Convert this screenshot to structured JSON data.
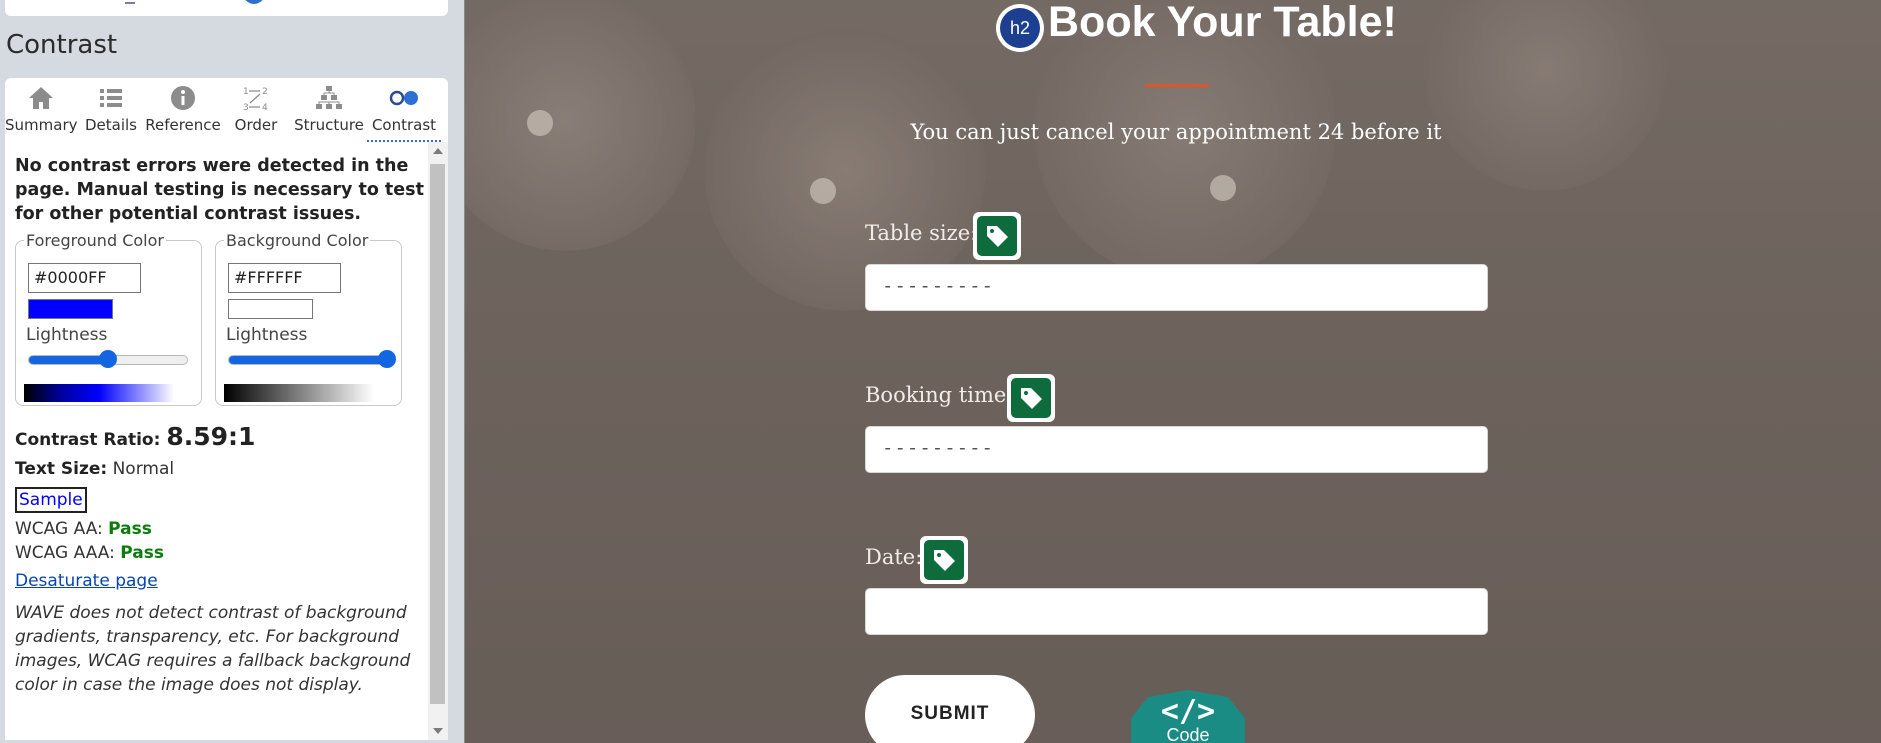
{
  "sidebar": {
    "section_title": "Contrast",
    "tabs": [
      {
        "label": "Summary",
        "icon": "home-icon"
      },
      {
        "label": "Details",
        "icon": "list-icon"
      },
      {
        "label": "Reference",
        "icon": "info-icon"
      },
      {
        "label": "Order",
        "icon": "order-icon"
      },
      {
        "label": "Structure",
        "icon": "structure-icon"
      },
      {
        "label": "Contrast",
        "icon": "contrast-icon",
        "active": true
      }
    ],
    "message": "No contrast errors were detected in the page. Manual testing is necessary to test for other potential contrast issues.",
    "foreground": {
      "legend": "Foreground Color",
      "hex": "#0000FF",
      "lightness_label": "Lightness",
      "lightness_percent": 50
    },
    "background": {
      "legend": "Background Color",
      "hex": "#FFFFFF",
      "lightness_label": "Lightness",
      "lightness_percent": 100
    },
    "contrast_ratio_label": "Contrast Ratio:",
    "contrast_ratio_value": "8.59:1",
    "text_size_label": "Text Size:",
    "text_size_value": "Normal",
    "sample_label": "Sample",
    "wcag_aa_label": "WCAG AA:",
    "wcag_aa_value": "Pass",
    "wcag_aaa_label": "WCAG AAA:",
    "wcag_aaa_value": "Pass",
    "desaturate_link": "Desaturate page",
    "note": "WAVE does not detect contrast of background gradients, transparency, etc. For background images, WCAG requires a fallback background color in case the image does not display."
  },
  "page": {
    "h2_badge": "h2",
    "title": "Book Your Table!",
    "subtitle": "You can just cancel your appointment 24 before it",
    "fields": [
      {
        "label": "Table size:",
        "value": "---------"
      },
      {
        "label": "Booking time:",
        "value": "---------"
      },
      {
        "label": "Date:",
        "value": ""
      }
    ],
    "submit_label": "SUBMIT",
    "code_badge_symbol": "</>",
    "code_badge_label": "Code"
  },
  "colors": {
    "accent": "#2d6fd3",
    "pass": "#0a7d0a",
    "tag_green": "#0d6b3c",
    "title_underline": "#d9572a",
    "code_badge": "#1a8c84"
  }
}
